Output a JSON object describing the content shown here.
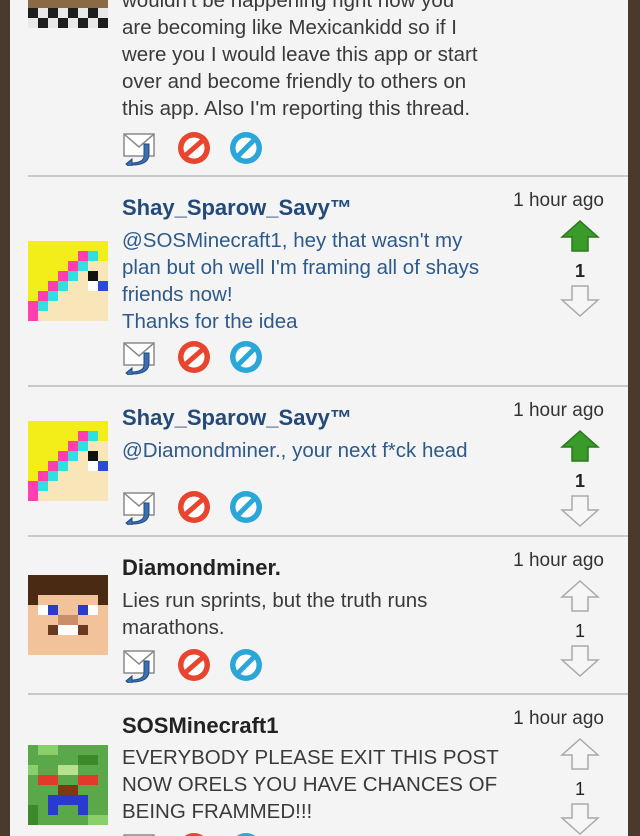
{
  "posts": [
    {
      "username": "",
      "time": "",
      "lines": [
        "wouldn't be happening right now you",
        "are becoming like Mexicankidd so if I",
        "were you I would leave this app or start",
        "over and become friendly to others on",
        "this app. Also I'm reporting this thread."
      ],
      "score": ""
    },
    {
      "username": "Shay_Sparow_Savy™",
      "time": "1 hour ago",
      "lines": [
        "@SOSMinecraft1, hey that wasn't my",
        "plan but oh well I'm framing all of shays",
        "friends now!",
        "Thanks for the idea"
      ],
      "score": "1"
    },
    {
      "username": "Shay_Sparow_Savy™",
      "time": "1 hour ago",
      "lines": [
        "@Diamondminer., your next f*ck head"
      ],
      "score": "1"
    },
    {
      "username": "Diamondminer.",
      "time": "1 hour ago",
      "lines": [
        "Lies run sprints, but the truth runs",
        "marathons."
      ],
      "score": "1"
    },
    {
      "username": "SOSMinecraft1",
      "time": "1 hour ago",
      "lines": [
        "EVERYBODY PLEASE EXIT THIS POST",
        "NOW ORELS YOU HAVE CHANCES OF",
        "BEING FRAMMED!!!"
      ],
      "score": "1"
    }
  ],
  "icons": {
    "reply": "reply-envelope-icon",
    "block": "block-icon",
    "moderate": "moderate-icon",
    "upvote": "upvote-arrow-icon",
    "downvote": "downvote-arrow-icon"
  },
  "colors": {
    "upvote_active": "#3a9a2a",
    "block_red": "#e8442e",
    "moderate_blue": "#2aa7d8",
    "username_blue": "#234a78"
  }
}
